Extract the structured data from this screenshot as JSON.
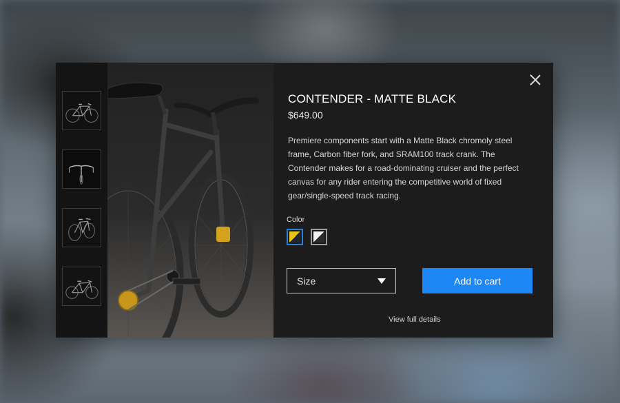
{
  "product": {
    "title": "CONTENDER - MATTE BLACK",
    "price": "$649.00",
    "description": "Premiere components start with a Matte Black chromoly steel frame, Carbon fiber fork, and SRAM100 track crank. The Contender makes for a road-dominating cruiser and the perfect canvas for any rider entering the competitive world of fixed gear/single-speed track racing."
  },
  "color": {
    "label": "Color",
    "swatches": [
      {
        "name": "black-gold",
        "colors": [
          "#e9c21c",
          "#23272b"
        ],
        "selected": true
      },
      {
        "name": "black-white",
        "colors": [
          "#f2f2f2",
          "#2a2a2a"
        ],
        "selected": false
      }
    ]
  },
  "size": {
    "label": "Size"
  },
  "actions": {
    "add_to_cart": "Add to cart",
    "view_details": "View full details"
  },
  "icons": {
    "close": "close-icon",
    "caret": "chevron-down-icon"
  },
  "colors": {
    "accent": "#1e87f6",
    "modal_bg": "#1c1c1c"
  }
}
